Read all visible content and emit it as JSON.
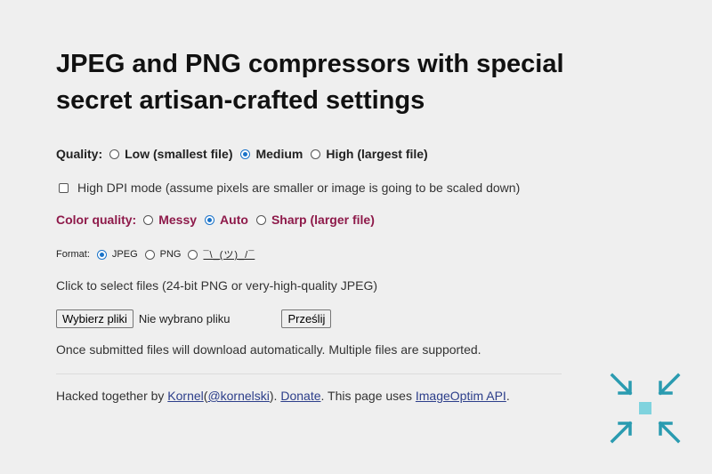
{
  "title": "JPEG and PNG compressors with special secret artisan-crafted settings",
  "quality": {
    "label": "Quality:",
    "options": [
      "Low (smallest file)",
      "Medium",
      "High (largest file)"
    ],
    "selected": "Medium"
  },
  "dpi": {
    "label": "High DPI mode (assume pixels are smaller or image is going to be scaled down)",
    "checked": false
  },
  "color_quality": {
    "label": "Color quality:",
    "options": [
      "Messy",
      "Auto",
      "Sharp (larger file)"
    ],
    "selected": "Auto",
    "color": "#8e1a4a"
  },
  "format": {
    "label": "Format:",
    "options": [
      "JPEG",
      "PNG",
      "¯\\_(ツ)_/¯"
    ],
    "selected": "JPEG"
  },
  "select_text": "Click to select files (24-bit PNG or very-high-quality JPEG)",
  "file_input": {
    "button_label": "Wybierz pliki",
    "status": "Nie wybrano pliku",
    "submit_label": "Prześlij"
  },
  "once_text": "Once submitted files will download automatically. Multiple files are supported.",
  "footer": {
    "prefix": "Hacked together by ",
    "author": "Kornel",
    "paren_open": " (",
    "handle": "@kornelski",
    "paren_close": "). ",
    "donate": "Donate",
    "middle": ". This page uses ",
    "api": "ImageOptim API",
    "end": "."
  },
  "logo": {
    "icon": "compress-arrows-icon",
    "color": "#2a9bb0",
    "center_color": "#7fd3de"
  }
}
